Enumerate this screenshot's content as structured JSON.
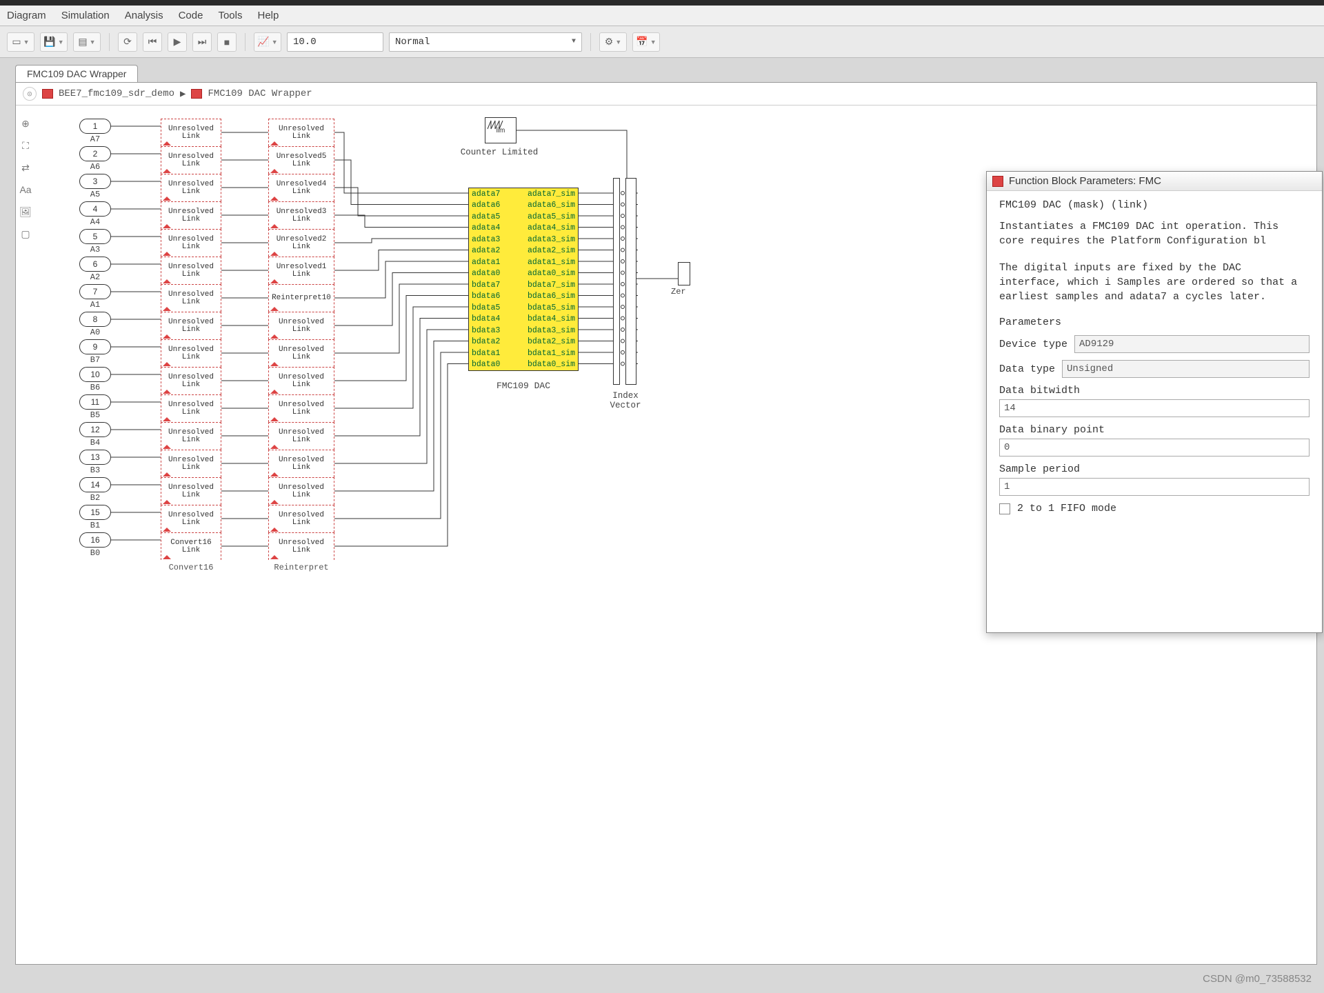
{
  "menu": {
    "items": [
      "Diagram",
      "Simulation",
      "Analysis",
      "Code",
      "Tools",
      "Help"
    ]
  },
  "toolbar": {
    "stop_time": "10.0",
    "sim_mode": "Normal"
  },
  "tab": {
    "title": "FMC109 DAC Wrapper"
  },
  "breadcrumb": {
    "root": "BEE7_fmc109_sdr_demo",
    "sep": "▶",
    "leaf": "FMC109 DAC Wrapper"
  },
  "inputs": [
    {
      "n": "1",
      "lbl": "A7"
    },
    {
      "n": "2",
      "lbl": "A6"
    },
    {
      "n": "3",
      "lbl": "A5"
    },
    {
      "n": "4",
      "lbl": "A4"
    },
    {
      "n": "5",
      "lbl": "A3"
    },
    {
      "n": "6",
      "lbl": "A2"
    },
    {
      "n": "7",
      "lbl": "A1"
    },
    {
      "n": "8",
      "lbl": "A0"
    },
    {
      "n": "9",
      "lbl": "B7"
    },
    {
      "n": "10",
      "lbl": "B6"
    },
    {
      "n": "11",
      "lbl": "B5"
    },
    {
      "n": "12",
      "lbl": "B4"
    },
    {
      "n": "13",
      "lbl": "B3"
    },
    {
      "n": "14",
      "lbl": "B2"
    },
    {
      "n": "15",
      "lbl": "B1"
    },
    {
      "n": "16",
      "lbl": "B0"
    }
  ],
  "convert": {
    "label": "Convert16",
    "cells": [
      "Unresolved Link",
      "Unresolved Link",
      "Unresolved Link",
      "Unresolved Link",
      "Unresolved Link",
      "Unresolved Link",
      "Unresolved Link",
      "Unresolved Link",
      "Unresolved Link",
      "Unresolved Link",
      "Unresolved Link",
      "Unresolved Link",
      "Unresolved Link",
      "Unresolved Link",
      "Unresolved Link",
      "Convert16 Link"
    ]
  },
  "reinterpret": {
    "label": "Reinterpret",
    "cells": [
      "Unresolved Link",
      "Unresolved5 Link",
      "Unresolved4 Link",
      "Unresolved3 Link",
      "Unresolved2 Link",
      "Unresolved1 Link",
      "Reinterpret10",
      "Unresolved Link",
      "Unresolved Link",
      "Unresolved Link",
      "Unresolved Link",
      "Unresolved Link",
      "Unresolved Link",
      "Unresolved Link",
      "Unresolved Link",
      "Unresolved Link"
    ]
  },
  "dac": {
    "label": "FMC109 DAC",
    "rows": [
      {
        "l": "adata7",
        "r": "adata7_sim"
      },
      {
        "l": "adata6",
        "r": "adata6_sim"
      },
      {
        "l": "adata5",
        "r": "adata5_sim"
      },
      {
        "l": "adata4",
        "r": "adata4_sim"
      },
      {
        "l": "adata3",
        "r": "adata3_sim"
      },
      {
        "l": "adata2",
        "r": "adata2_sim"
      },
      {
        "l": "adata1",
        "r": "adata1_sim"
      },
      {
        "l": "adata0",
        "r": "adata0_sim"
      },
      {
        "l": "bdata7",
        "r": "bdata7_sim"
      },
      {
        "l": "bdata6",
        "r": "bdata6_sim"
      },
      {
        "l": "bdata5",
        "r": "bdata5_sim"
      },
      {
        "l": "bdata4",
        "r": "bdata4_sim"
      },
      {
        "l": "bdata3",
        "r": "bdata3_sim"
      },
      {
        "l": "bdata2",
        "r": "bdata2_sim"
      },
      {
        "l": "bdata1",
        "r": "bdata1_sim"
      },
      {
        "l": "bdata0",
        "r": "bdata0_sim"
      }
    ]
  },
  "counter": {
    "label": "Counter Limited",
    "text": "lim"
  },
  "indexvec": {
    "label": "Index Vector"
  },
  "zero": {
    "label": "Zer"
  },
  "dialog": {
    "title": "Function Block Parameters: FMC",
    "mask": "FMC109 DAC (mask) (link)",
    "desc1": "Instantiates a FMC109 DAC int operation. This core requires the Platform Configuration bl",
    "desc2": "The digital inputs are fixed by the DAC interface, which i Samples are ordered so that a earliest samples and adata7 a cycles later.",
    "params_hd": "Parameters",
    "device_lbl": "Device type",
    "device_val": "AD9129",
    "data_lbl": "Data type",
    "data_val": "Unsigned",
    "bitwidth_lbl": "Data bitwidth",
    "bitwidth_val": "14",
    "binpt_lbl": "Data binary point",
    "binpt_val": "0",
    "period_lbl": "Sample period",
    "period_val": "1",
    "fifo_lbl": "2 to 1 FIFO mode"
  },
  "watermark": "CSDN @m0_73588532"
}
